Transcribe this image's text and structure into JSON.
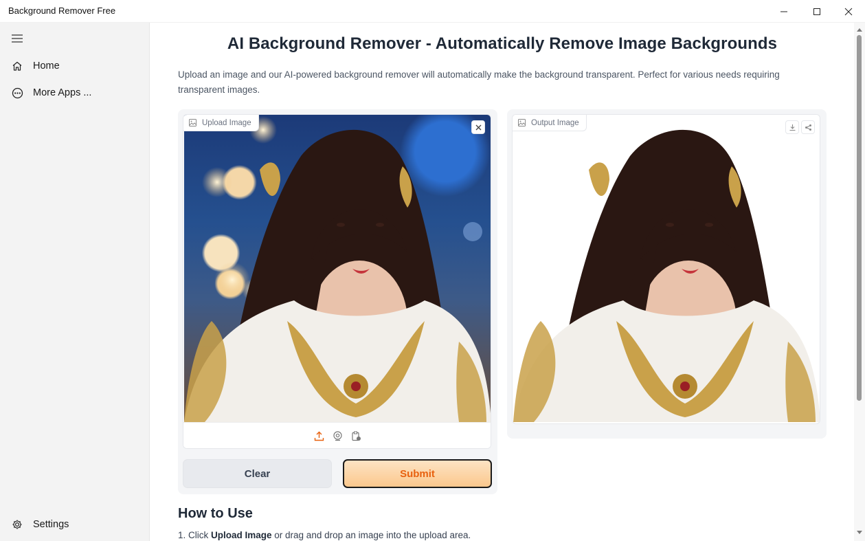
{
  "window": {
    "title": "Background Remover Free"
  },
  "sidebar": {
    "items": [
      {
        "label": "Home",
        "icon": "home-icon"
      },
      {
        "label": "More Apps ...",
        "icon": "more-apps-icon"
      }
    ],
    "settings": {
      "label": "Settings",
      "icon": "gear-icon"
    }
  },
  "main": {
    "title": "AI Background Remover - Automatically Remove Image Backgrounds",
    "description": "Upload an image and our AI-powered background remover will automatically make the background transparent. Perfect for various needs requiring transparent images.",
    "upload": {
      "label": "Upload Image"
    },
    "output": {
      "label": "Output Image"
    },
    "buttons": {
      "clear": "Clear",
      "submit": "Submit"
    },
    "how_to": {
      "heading": "How to Use",
      "step1_prefix": "1. Click ",
      "step1_bold": "Upload Image",
      "step1_suffix": " or drag and drop an image into the upload area."
    }
  },
  "colors": {
    "accent": "#e8610f",
    "submit_bg": "#fbc88d",
    "panel_bg": "#f4f5f7"
  }
}
